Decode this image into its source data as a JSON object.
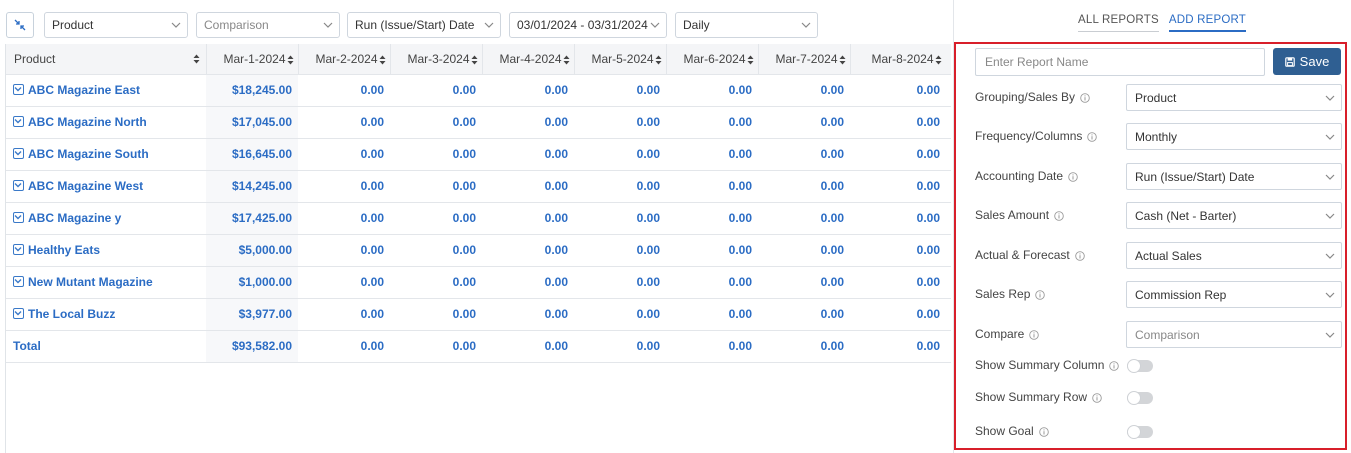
{
  "toolbar": {
    "product_value": "Product",
    "comparison_placeholder": "Comparison",
    "date_type_value": "Run (Issue/Start) Date",
    "date_range_value": "03/01/2024 - 03/31/2024",
    "interval_value": "Daily"
  },
  "table": {
    "columns": [
      "Product",
      "Mar-1-2024",
      "Mar-2-2024",
      "Mar-3-2024",
      "Mar-4-2024",
      "Mar-5-2024",
      "Mar-6-2024",
      "Mar-7-2024",
      "Mar-8-2024"
    ],
    "rows": [
      {
        "name": "ABC Magazine East",
        "values": [
          "$18,245.00",
          "0.00",
          "0.00",
          "0.00",
          "0.00",
          "0.00",
          "0.00",
          "0.00"
        ]
      },
      {
        "name": "ABC Magazine North",
        "values": [
          "$17,045.00",
          "0.00",
          "0.00",
          "0.00",
          "0.00",
          "0.00",
          "0.00",
          "0.00"
        ]
      },
      {
        "name": "ABC Magazine South",
        "values": [
          "$16,645.00",
          "0.00",
          "0.00",
          "0.00",
          "0.00",
          "0.00",
          "0.00",
          "0.00"
        ]
      },
      {
        "name": "ABC Magazine West",
        "values": [
          "$14,245.00",
          "0.00",
          "0.00",
          "0.00",
          "0.00",
          "0.00",
          "0.00",
          "0.00"
        ]
      },
      {
        "name": "ABC Magazine y",
        "values": [
          "$17,425.00",
          "0.00",
          "0.00",
          "0.00",
          "0.00",
          "0.00",
          "0.00",
          "0.00"
        ]
      },
      {
        "name": "Healthy Eats",
        "values": [
          "$5,000.00",
          "0.00",
          "0.00",
          "0.00",
          "0.00",
          "0.00",
          "0.00",
          "0.00"
        ]
      },
      {
        "name": "New Mutant Magazine",
        "values": [
          "$1,000.00",
          "0.00",
          "0.00",
          "0.00",
          "0.00",
          "0.00",
          "0.00",
          "0.00"
        ]
      },
      {
        "name": "The Local Buzz",
        "values": [
          "$3,977.00",
          "0.00",
          "0.00",
          "0.00",
          "0.00",
          "0.00",
          "0.00",
          "0.00"
        ]
      }
    ],
    "total": {
      "name": "Total",
      "values": [
        "$93,582.00",
        "0.00",
        "0.00",
        "0.00",
        "0.00",
        "0.00",
        "0.00",
        "0.00"
      ]
    }
  },
  "panel": {
    "tabs": [
      "ALL REPORTS",
      "ADD REPORT"
    ],
    "report_name_placeholder": "Enter Report Name",
    "save_label": "Save",
    "fields": [
      {
        "label": "Grouping/Sales By",
        "value": "Product",
        "placeholder": false
      },
      {
        "label": "Frequency/Columns",
        "value": "Monthly",
        "placeholder": false
      },
      {
        "label": "Accounting Date",
        "value": "Run (Issue/Start) Date",
        "placeholder": false
      },
      {
        "label": "Sales Amount",
        "value": "Cash (Net - Barter)",
        "placeholder": false
      },
      {
        "label": "Actual & Forecast",
        "value": "Actual Sales",
        "placeholder": false
      },
      {
        "label": "Sales Rep",
        "value": "Commission Rep",
        "placeholder": false
      },
      {
        "label": "Compare",
        "value": "Comparison",
        "placeholder": true
      }
    ],
    "toggles": [
      {
        "label": "Show Summary Column",
        "on": false
      },
      {
        "label": "Show Summary Row",
        "on": false
      },
      {
        "label": "Show Goal",
        "on": false
      }
    ]
  },
  "colors": {
    "link_blue": "#2b6cc4",
    "save_button": "#2f5f92",
    "highlight_border": "#d81f2a"
  }
}
